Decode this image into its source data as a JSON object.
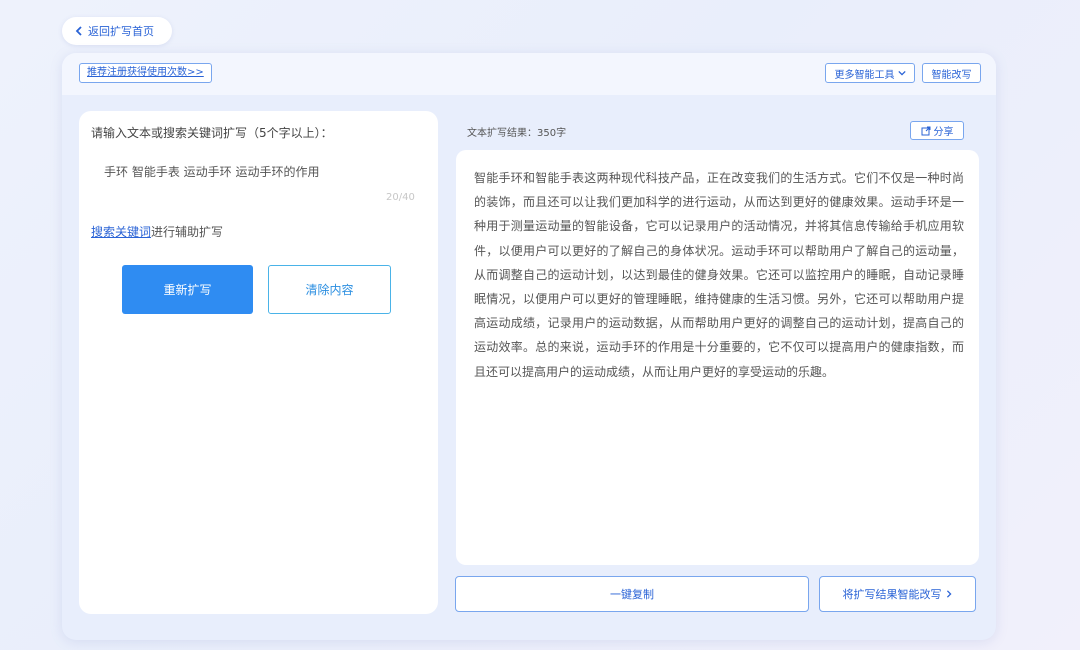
{
  "nav": {
    "back_label": "返回扩写首页"
  },
  "toolbar": {
    "register_link": "推荐注册获得使用次数>>",
    "more_tools": "更多智能工具",
    "smart_rewrite": "智能改写"
  },
  "input": {
    "prompt": "请输入文本或搜索关键词扩写（5个字以上）：",
    "value": "手环 智能手表 运动手环 运动手环的作用",
    "count": "20/40",
    "search_link": "搜索关键词",
    "search_suffix": "进行辅助扩写",
    "rewrite_button": "重新扩写",
    "clear_button": "清除内容"
  },
  "result": {
    "label": "文本扩写结果：350字",
    "share": "分享",
    "text": "智能手环和智能手表这两种现代科技产品，正在改变我们的生活方式。它们不仅是一种时尚的装饰，而且还可以让我们更加科学的进行运动，从而达到更好的健康效果。运动手环是一种用于测量运动量的智能设备，它可以记录用户的活动情况，并将其信息传输给手机应用软件，以便用户可以更好的了解自己的身体状况。运动手环可以帮助用户了解自己的运动量，从而调整自己的运动计划，以达到最佳的健身效果。它还可以监控用户的睡眠，自动记录睡眠情况，以便用户可以更好的管理睡眠，维持健康的生活习惯。另外，它还可以帮助用户提高运动成绩，记录用户的运动数据，从而帮助用户更好的调整自己的运动计划，提高自己的运动效率。总的来说，运动手环的作用是十分重要的，它不仅可以提高用户的健康指数，而且还可以提高用户的运动成绩，从而让用户更好的享受运动的乐趣。",
    "copy_button": "一键复制",
    "rewrite_result_button": "将扩写结果智能改写"
  },
  "colors": {
    "accent": "#2f8cf2",
    "link": "#2a63d6",
    "border": "#79a6ee"
  }
}
